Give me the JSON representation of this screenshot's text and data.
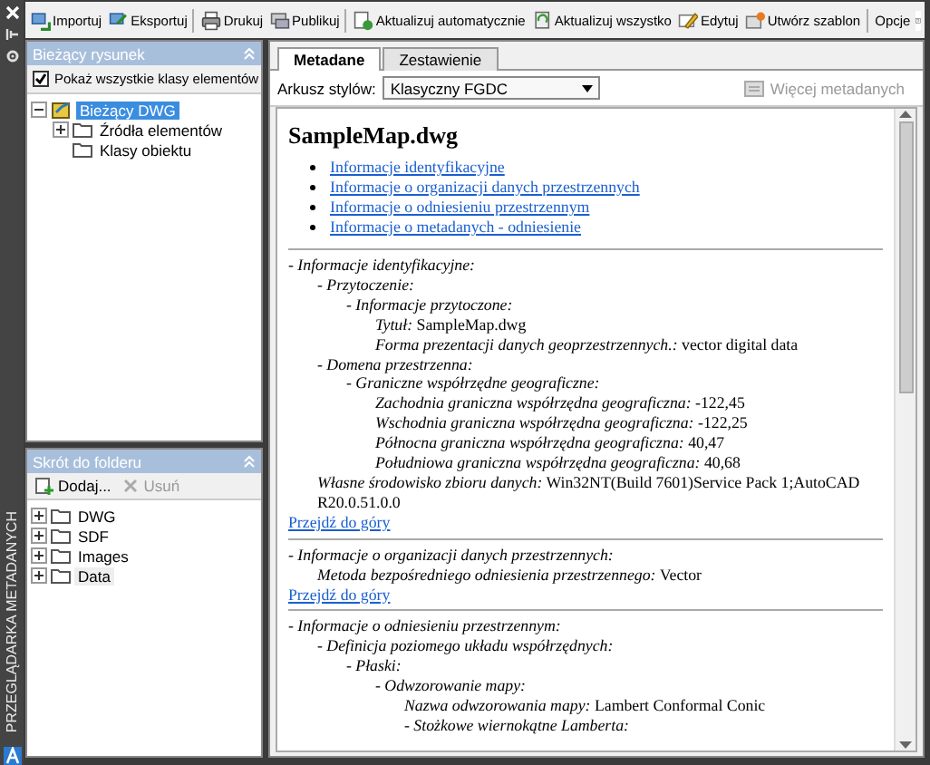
{
  "side_strip": {
    "title": "PRZEGLĄDARKA METADANYCH"
  },
  "toolbar": [
    {
      "label": "Importuj",
      "kind": "import",
      "separator_after": false
    },
    {
      "label": "Eksportuj",
      "kind": "export",
      "separator_after": true
    },
    {
      "label": "Drukuj",
      "kind": "print",
      "separator_after": false
    },
    {
      "label": "Publikuj",
      "kind": "publish",
      "separator_after": true
    },
    {
      "label": "Aktualizuj automatycznie",
      "kind": "autoupdate",
      "separator_after": false
    },
    {
      "label": "Aktualizuj wszystko",
      "kind": "update",
      "separator_after": false
    },
    {
      "label": "Edytuj",
      "kind": "edit",
      "separator_after": false
    },
    {
      "label": "Utwórz szablon",
      "kind": "template",
      "separator_after": true
    },
    {
      "label": "Opcje",
      "kind": "text",
      "separator_after": false
    }
  ],
  "current_drawing": {
    "title": "Bieżący rysunek",
    "show_all": {
      "label": "Pokaż wszystkie klasy elementów",
      "checked": true
    },
    "tree": [
      {
        "label": "Bieżący DWG",
        "selected": true,
        "expanded": true,
        "children": [
          {
            "label": "Źródła elementów",
            "selected": false,
            "expanded": false
          },
          {
            "label": "Klasy obiektu",
            "selected": false
          }
        ]
      }
    ]
  },
  "folder_shortcut": {
    "title": "Skrót do folderu",
    "buttons": [
      {
        "label": "Dodaj...",
        "disabled": false
      },
      {
        "label": "Usuń",
        "disabled": true
      }
    ],
    "tree": [
      {
        "label": "DWG",
        "selected": false,
        "expanded": false
      },
      {
        "label": "SDF",
        "selected": false,
        "expanded": false
      },
      {
        "label": "Images",
        "selected": false,
        "expanded": false
      },
      {
        "label": "Data",
        "selected": true,
        "expanded": false
      }
    ]
  },
  "tabs": [
    {
      "label": "Metadane",
      "selected": true
    },
    {
      "label": "Zestawienie",
      "selected": false
    }
  ],
  "stylesheet": {
    "label": "Arkusz stylów:",
    "value": "Klasyczny FGDC"
  },
  "more_button": {
    "label": "Więcej metadanych",
    "disabled": true
  },
  "document": {
    "title": "SampleMap.dwg",
    "links": [
      "Informacje identyfikacyjne",
      "Informacje o organizacji danych przestrzennych",
      "Informacje o odniesieniu przestrzennym",
      "Informacje o metadanych - odniesienie"
    ],
    "sections": [
      {
        "label": "- Informacje identyfikacyjne:",
        "top_link": "Przejdź do góry",
        "children": [
          {
            "label": "- Przytoczenie:",
            "children": [
              {
                "label": "- Informacje przytoczone:",
                "children": [
                  {
                    "label": "Tytuł:",
                    "value": "SampleMap.dwg"
                  },
                  {
                    "label": "Forma prezentacji danych geoprzestrzennych.:",
                    "value": "vector digital data"
                  }
                ]
              }
            ]
          },
          {
            "label": "- Domena przestrzenna:",
            "children": [
              {
                "label": "- Graniczne współrzędne geograficzne:",
                "children": [
                  {
                    "label": "Zachodnia graniczna współrzędna geograficzna:",
                    "value": "-122,45"
                  },
                  {
                    "label": "Wschodnia graniczna współrzędna geograficzna:",
                    "value": "-122,25"
                  },
                  {
                    "label": "Północna graniczna współrzędna geograficzna:",
                    "value": "40,47"
                  },
                  {
                    "label": "Południowa graniczna współrzędna geograficzna:",
                    "value": "40,68"
                  }
                ]
              }
            ]
          },
          {
            "label": "Własne środowisko zbioru danych:",
            "value": "Win32NT(Build 7601)Service Pack 1;AutoCAD R20.0.51.0.0"
          }
        ]
      },
      {
        "label": "- Informacje o organizacji danych przestrzennych:",
        "top_link": "Przejdź do góry",
        "children": [
          {
            "label": "Metoda bezpośredniego odniesienia przestrzennego:",
            "value": "Vector"
          }
        ]
      },
      {
        "label": "- Informacje o odniesieniu przestrzennym:",
        "children": [
          {
            "label": "- Definicja poziomego układu współrzędnych:",
            "children": [
              {
                "label": "- Płaski:",
                "children": [
                  {
                    "label": "- Odwzorowanie mapy:",
                    "children": [
                      {
                        "label": "Nazwa odwzorowania mapy:",
                        "value": "Lambert Conformal Conic"
                      },
                      {
                        "label": "- Stożkowe wiernokątne Lamberta:"
                      }
                    ]
                  }
                ]
              }
            ]
          }
        ]
      }
    ]
  }
}
